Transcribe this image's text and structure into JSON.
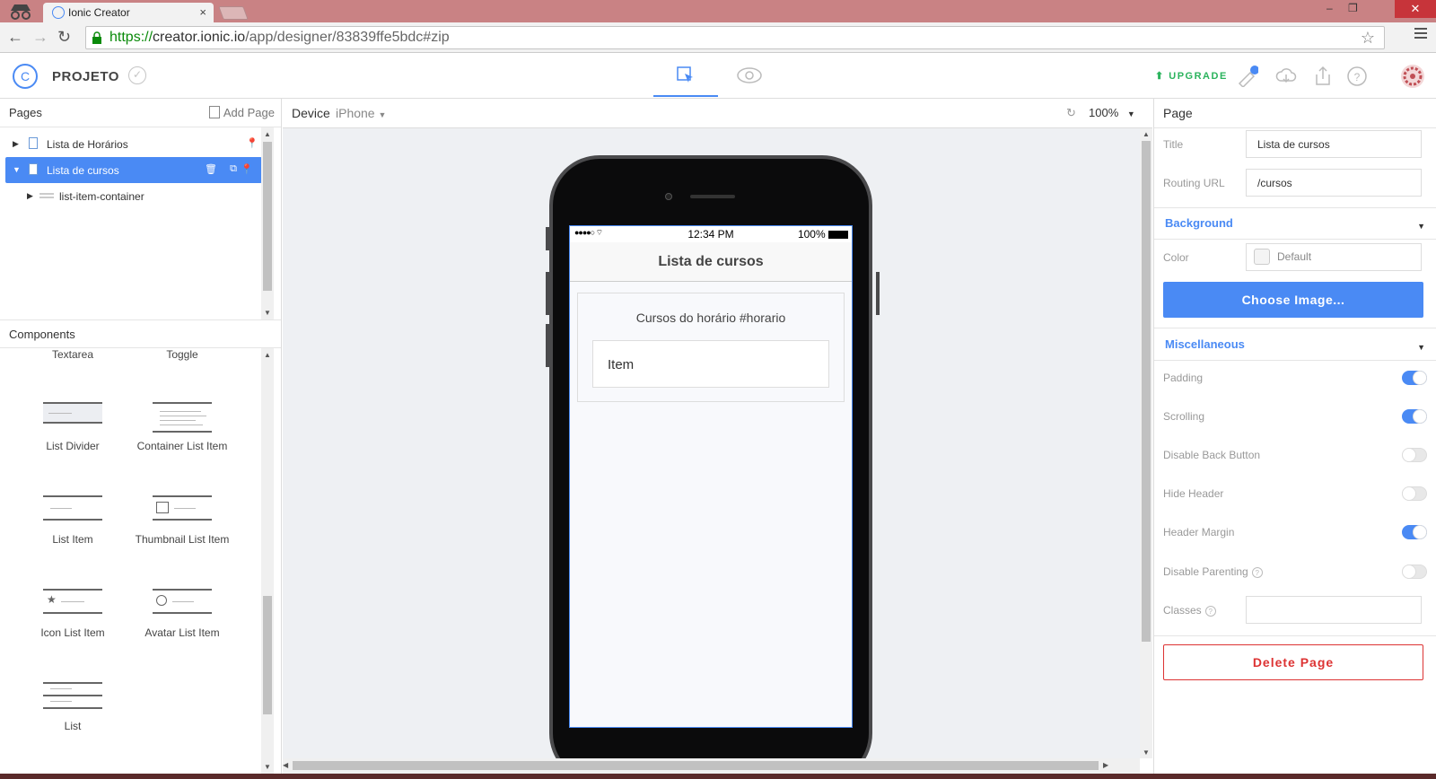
{
  "browser": {
    "tab_title": "Ionic Creator",
    "tab_close": "×",
    "url_scheme": "https://",
    "url_host": "creator.ionic.io",
    "url_path": "/app/designer/83839ffe5bdc#zip"
  },
  "header": {
    "project_name": "PROJETO",
    "upgrade_label": "UPGRADE"
  },
  "pages_panel": {
    "title": "Pages",
    "add_page_label": "Add Page",
    "tree": [
      {
        "label": "Lista de Horários"
      },
      {
        "label": "Lista de cursos"
      },
      {
        "label": "list-item-container"
      }
    ]
  },
  "components_panel": {
    "title": "Components",
    "items": [
      "Textarea",
      "Toggle",
      "List Divider",
      "Container List Item",
      "List Item",
      "Thumbnail List Item",
      "Icon List Item",
      "Avatar List Item",
      "List"
    ]
  },
  "canvas": {
    "device_label": "Device",
    "device_value": "iPhone",
    "zoom_value": "100%"
  },
  "phone_screen": {
    "status_time": "12:34 PM",
    "status_battery": "100%",
    "nav_title": "Lista de cursos",
    "list_title": "Cursos do horário #horario",
    "list_item": "Item"
  },
  "properties": {
    "panel_title": "Page",
    "title_label": "Title",
    "title_value": "Lista de cursos",
    "routing_label": "Routing URL",
    "routing_value": "/cursos",
    "background_section": "Background",
    "color_label": "Color",
    "color_value": "Default",
    "choose_image_label": "Choose Image...",
    "misc_section": "Miscellaneous",
    "toggles": [
      {
        "label": "Padding",
        "on": true
      },
      {
        "label": "Scrolling",
        "on": true
      },
      {
        "label": "Disable Back Button",
        "on": false
      },
      {
        "label": "Hide Header",
        "on": false
      },
      {
        "label": "Header Margin",
        "on": true
      },
      {
        "label": "Disable Parenting",
        "on": false
      }
    ],
    "classes_label": "Classes",
    "classes_value": "",
    "delete_label": "Delete Page"
  },
  "colors": {
    "accent": "#4a8af4",
    "danger": "#dd3333",
    "upgrade": "#2bb35d"
  }
}
